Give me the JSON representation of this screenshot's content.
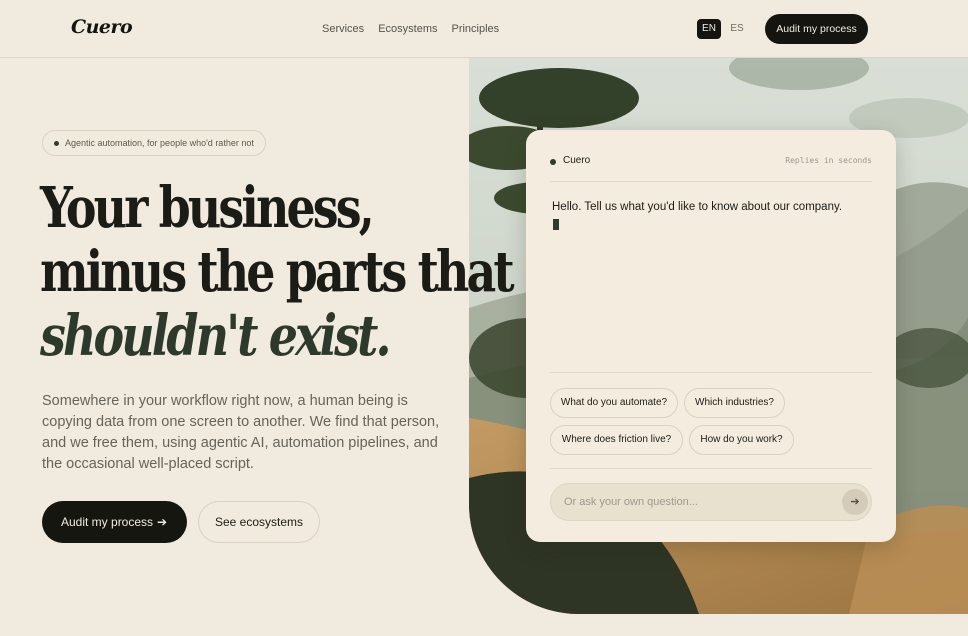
{
  "header": {
    "logo": "Cuero",
    "nav": [
      "Services",
      "Ecosystems",
      "Principles"
    ],
    "languages": {
      "active": "EN",
      "inactive": "ES"
    },
    "cta": "Audit my process"
  },
  "hero": {
    "badge": "Agentic automation, for people who'd rather not",
    "headline_line1": "Your business,",
    "headline_line2": "minus the parts that",
    "headline_line3": "shouldn't exist.",
    "lede": "Somewhere in your workflow right now, a human being is copying data from one screen to another. We find that person, and we free them, using agentic AI, automation pipelines, and the occasional well-placed script.",
    "primary_button": "Audit my process",
    "primary_button_icon": "arrow-right-icon",
    "secondary_button": "See ecosystems"
  },
  "chat": {
    "name": "Cuero",
    "status": "Replies in seconds",
    "message": "Hello. Tell us what you'd like to know about our company.",
    "suggestions": [
      "What do you automate?",
      "Which industries?",
      "Where does friction live?",
      "How do you work?"
    ],
    "input_placeholder": "Or ask your own question...",
    "send_icon": "arrow-right-icon"
  },
  "colors": {
    "background": "#f1ebdf",
    "ink": "#141410",
    "accent_green": "#2f3b2c",
    "muted_text": "#66635a"
  }
}
